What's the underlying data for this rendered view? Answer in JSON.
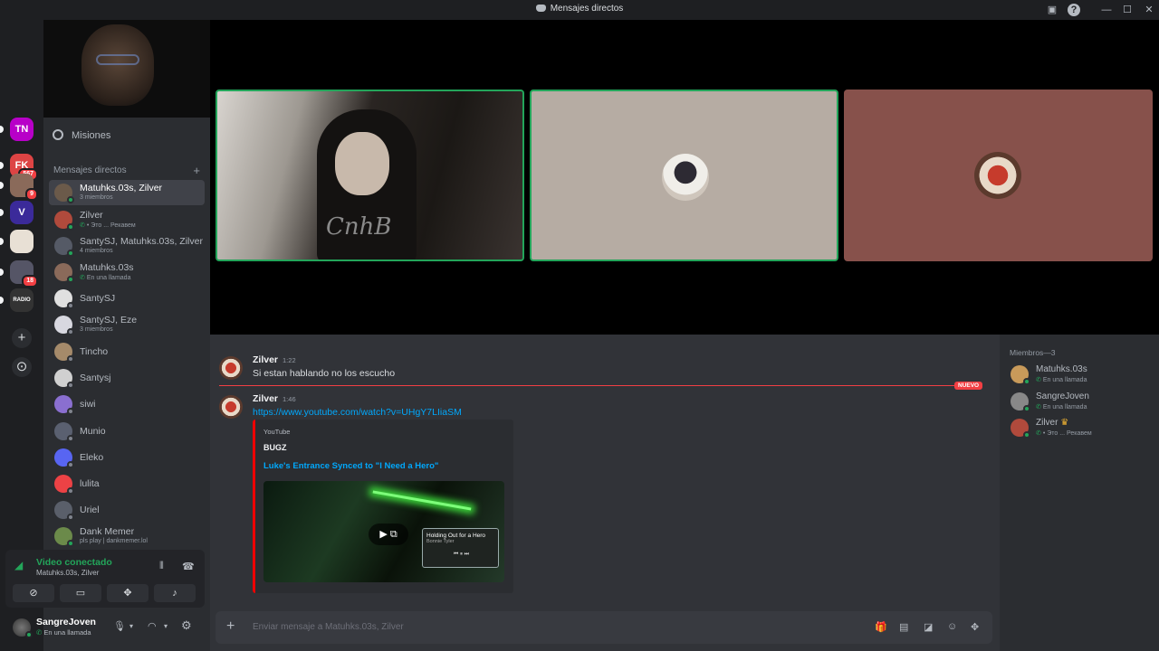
{
  "window": {
    "title": "Mensajes directos"
  },
  "servers": [
    {
      "name": "TN",
      "badge": "",
      "color": "#b800c8"
    },
    {
      "name": "FK",
      "badge": "567",
      "color": "#d44"
    },
    {
      "name": "",
      "badge": "9",
      "color": "#8a6a5a"
    },
    {
      "name": "V",
      "badge": "",
      "color": "#3b2a9a"
    },
    {
      "name": "",
      "badge": "",
      "color": "#e8e0d5"
    },
    {
      "name": "",
      "badge": "18",
      "color": "#556"
    },
    {
      "name": "RADIO",
      "badge": "",
      "color": "#333"
    }
  ],
  "sidebar": {
    "quests_label": "Misiones",
    "dm_header": "Mensajes directos",
    "dms": [
      {
        "name": "Matuhks.03s, Zilver",
        "sub": "3 miembros",
        "call": false,
        "selected": true,
        "status": "online"
      },
      {
        "name": "Zilver",
        "sub": "• Это ... Рекавем",
        "call": true,
        "selected": false,
        "status": "online"
      },
      {
        "name": "SantySJ, Matuhks.03s, Zilver",
        "sub": "4 miembros",
        "call": false,
        "selected": false,
        "status": "online"
      },
      {
        "name": "Matuhks.03s",
        "sub": "En una llamada",
        "call": true,
        "selected": false,
        "status": "online"
      },
      {
        "name": "SantySJ",
        "sub": "",
        "call": false,
        "selected": false,
        "status": "offline"
      },
      {
        "name": "SantySJ, Eze",
        "sub": "3 miembros",
        "call": false,
        "selected": false,
        "status": "offline"
      },
      {
        "name": "Tincho",
        "sub": "",
        "call": false,
        "selected": false,
        "status": "offline"
      },
      {
        "name": "Santysj",
        "sub": "",
        "call": false,
        "selected": false,
        "status": "offline"
      },
      {
        "name": "siwi",
        "sub": "",
        "call": false,
        "selected": false,
        "status": "offline"
      },
      {
        "name": "Munio",
        "sub": "",
        "call": false,
        "selected": false,
        "status": "offline"
      },
      {
        "name": "Eleko",
        "sub": "",
        "call": false,
        "selected": false,
        "status": "offline"
      },
      {
        "name": "lulita",
        "sub": "",
        "call": false,
        "selected": false,
        "status": "offline"
      },
      {
        "name": "Uriel",
        "sub": "",
        "call": false,
        "selected": false,
        "status": "offline"
      },
      {
        "name": "Dank Memer",
        "sub": "pls play | dankmemer.lol",
        "call": false,
        "selected": false,
        "status": "online"
      }
    ]
  },
  "voice": {
    "status": "Video conectado",
    "channel": "Matuhks.03s, Zilver"
  },
  "user": {
    "name": "SangreJoven",
    "status": "En una llamada"
  },
  "chat": {
    "messages": [
      {
        "author": "Zilver",
        "time": "1:22",
        "text": "Si estan hablando no los escucho"
      },
      {
        "author": "Zilver",
        "time": "1:46",
        "text": "https://www.youtube.com/watch?v=UHgY7LIiaSM"
      }
    ],
    "new_label": "NUEVO",
    "embed": {
      "provider": "YouTube",
      "author": "BUGZ",
      "title": "Luke's Entrance Synced to \"I Need a Hero\"",
      "mini_player": {
        "title": "Holding Out for a Hero",
        "artist": "Bonnie Tyler"
      }
    },
    "composer_placeholder": "Enviar mensaje a Matuhks.03s, Zilver"
  },
  "members": {
    "header": "Miembros—3",
    "list": [
      {
        "name": "Matuhks.03s",
        "sub": "En una llamada",
        "crown": false
      },
      {
        "name": "SangreJoven",
        "sub": "En una llamada",
        "crown": false
      },
      {
        "name": "Zilver",
        "sub": "• Это ... Рекавем",
        "crown": true
      }
    ]
  },
  "colors": {
    "accent": "#5865f2",
    "online": "#23a55a",
    "danger": "#f23f43",
    "link": "#00a8fc"
  },
  "icons": [
    "discord-logo-icon",
    "inbox-icon",
    "help-icon",
    "minimize-icon",
    "maximize-icon",
    "close-icon",
    "quests-icon",
    "plus-icon",
    "signal-icon",
    "noise-icon",
    "disconnect-icon",
    "camera-off-icon",
    "screen-share-icon",
    "activities-icon",
    "soundboard-icon",
    "mic-icon",
    "headphones-icon",
    "settings-icon",
    "gift-icon",
    "gif-icon",
    "sticker-icon",
    "emoji-icon",
    "apps-icon",
    "play-icon",
    "crown-icon",
    "phone-icon"
  ]
}
